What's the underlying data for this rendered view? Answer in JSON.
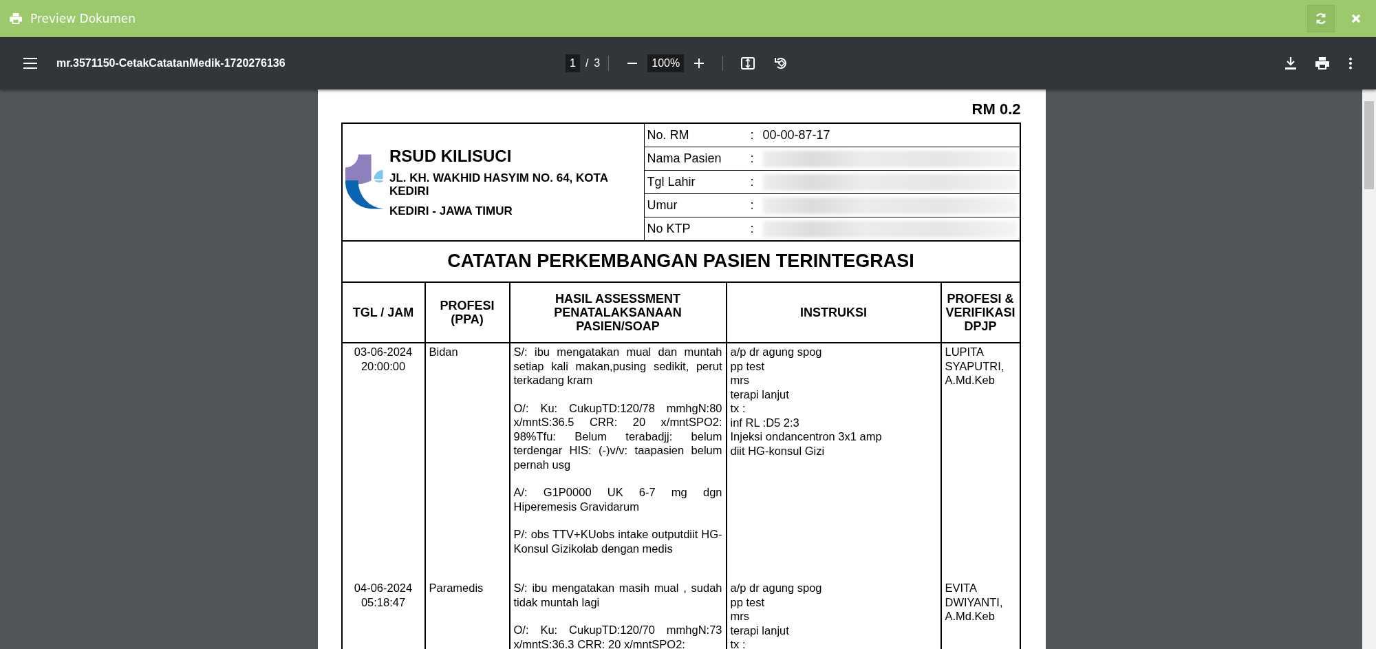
{
  "title_bar": {
    "title": "Preview Dokumen"
  },
  "toolbar": {
    "filename": "mr.3571150-CetakCatatanMedik-1720276136",
    "page": "1",
    "page_separator": "/",
    "page_count": "3",
    "zoom": "100%"
  },
  "document": {
    "form_code": "RM 0.2",
    "hospital": {
      "name": "RSUD KILISUCI",
      "address": "JL. KH. WAKHID HASYIM NO. 64, KOTA KEDIRI",
      "region": "KEDIRI - JAWA TIMUR"
    },
    "patient_fields": [
      {
        "label": "No. RM",
        "separator": ":",
        "value": "00-00-87-17",
        "redacted": false
      },
      {
        "label": "Nama Pasien",
        "separator": ":",
        "redacted": true
      },
      {
        "label": "Tgl Lahir",
        "separator": ":",
        "redacted": true
      },
      {
        "label": "Umur",
        "separator": ":",
        "redacted": true
      },
      {
        "label": "No KTP",
        "separator": ":",
        "redacted": true
      }
    ],
    "title": "CATATAN PERKEMBANGAN PASIEN TERINTEGRASI",
    "columns": [
      "TGL / JAM",
      "PROFESI (PPA)",
      "HASIL ASSESSMENT PENATALAKSANAAN PASIEN/SOAP",
      "INSTRUKSI",
      "PROFESI & VERIFIKASI DPJP"
    ],
    "rows": [
      {
        "date": "03-06-2024",
        "time": "20:00:00",
        "profession": "Bidan",
        "soap": [
          "S/: ibu mengatakan mual dan muntah setiap kali makan,pusing sedikit, perut terkadang kram",
          "O/: Ku: CukupTD:120/78 mmhgN:80 x/mntS:36.5 CRR: 20 x/mntSPO2: 98%Tfu: Belum terabadjj: belum terdengar HIS: (-)v/v: taapasien belum pernah usg",
          "A/: G1P0000 UK 6-7 mg dgn Hiperemesis Gravidarum",
          "P/: obs TTV+KUobs intake outputdiit HG-Konsul Gizikolab dengan medis"
        ],
        "instructions": [
          "a/p dr agung spog",
          "pp test",
          "mrs",
          "terapi lanjut",
          "tx :",
          "inf RL :D5 2:3",
          "Injeksi ondancentron 3x1 amp",
          "diit HG-konsul Gizi"
        ],
        "verifier": "LUPITA SYAPUTRI, A.Md.Keb"
      },
      {
        "date": "04-06-2024",
        "time": "05:18:47",
        "profession": "Paramedis",
        "soap": [
          "S/: ibu mengatakan masih mual , sudah tidak muntah lagi",
          "O/: Ku: CukupTD:120/70 mmhgN:73 x/mntS:36.3 CRR: 20 x/mntSPO2:"
        ],
        "instructions": [
          "a/p dr agung spog",
          "pp test",
          "mrs",
          "terapi lanjut",
          "tx :"
        ],
        "verifier": "EVITA DWIYANTI, A.Md.Keb"
      }
    ]
  }
}
